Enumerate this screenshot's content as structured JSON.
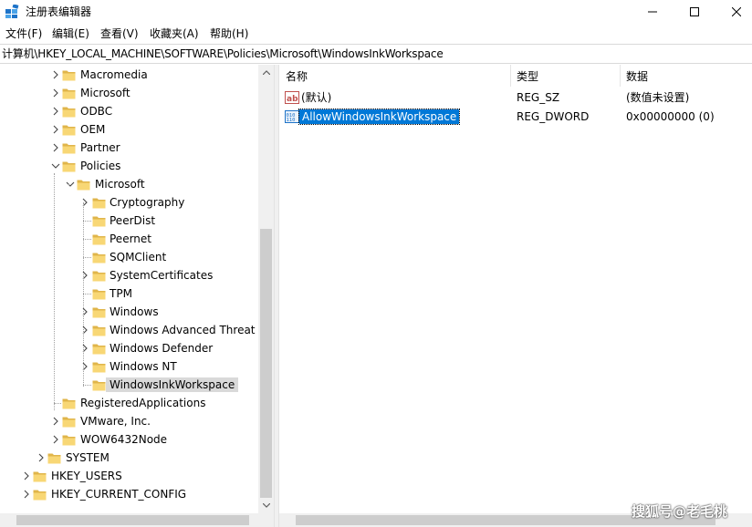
{
  "window": {
    "title": "注册表编辑器"
  },
  "menu": [
    "文件(F)",
    "编辑(E)",
    "查看(V)",
    "收藏夹(A)",
    "帮助(H)"
  ],
  "address": "计算机\\HKEY_LOCAL_MACHINE\\SOFTWARE\\Policies\\Microsoft\\WindowsInkWorkspace",
  "tree": [
    {
      "label": "Macromedia",
      "expander": "collapsed"
    },
    {
      "label": "Microsoft",
      "expander": "collapsed"
    },
    {
      "label": "ODBC",
      "expander": "collapsed"
    },
    {
      "label": "OEM",
      "expander": "collapsed"
    },
    {
      "label": "Partner",
      "expander": "collapsed"
    },
    {
      "label": "Policies",
      "expander": "expanded"
    },
    {
      "label": "Microsoft",
      "expander": "expanded"
    },
    {
      "label": "Cryptography",
      "expander": "collapsed"
    },
    {
      "label": "PeerDist",
      "expander": "none"
    },
    {
      "label": "Peernet",
      "expander": "none"
    },
    {
      "label": "SQMClient",
      "expander": "none"
    },
    {
      "label": "SystemCertificates",
      "expander": "collapsed"
    },
    {
      "label": "TPM",
      "expander": "none"
    },
    {
      "label": "Windows",
      "expander": "collapsed"
    },
    {
      "label": "Windows Advanced Threat P",
      "expander": "collapsed"
    },
    {
      "label": "Windows Defender",
      "expander": "collapsed"
    },
    {
      "label": "Windows NT",
      "expander": "collapsed"
    },
    {
      "label": "WindowsInkWorkspace",
      "expander": "none",
      "selected": true
    },
    {
      "label": "RegisteredApplications",
      "expander": "none"
    },
    {
      "label": "VMware, Inc.",
      "expander": "collapsed"
    },
    {
      "label": "WOW6432Node",
      "expander": "collapsed"
    },
    {
      "label": "SYSTEM",
      "expander": "collapsed"
    },
    {
      "label": "HKEY_USERS",
      "expander": "collapsed"
    },
    {
      "label": "HKEY_CURRENT_CONFIG",
      "expander": "collapsed"
    }
  ],
  "list": {
    "columns": {
      "name": "名称",
      "type": "类型",
      "data": "数据"
    },
    "rows": [
      {
        "icon": "string-value-icon",
        "name": "(默认)",
        "type": "REG_SZ",
        "data": "(数值未设置)"
      },
      {
        "icon": "dword-value-icon",
        "name": "AllowWindowsInkWorkspace",
        "type": "REG_DWORD",
        "data": "0x00000000 (0)",
        "selected": true
      }
    ]
  },
  "watermark": "搜狐号@老毛桃",
  "colors": {
    "selection": "#0078d7",
    "folder": "#f8d775",
    "folder_dark": "#e0b54a",
    "icon_blue": "#1e73c8"
  }
}
